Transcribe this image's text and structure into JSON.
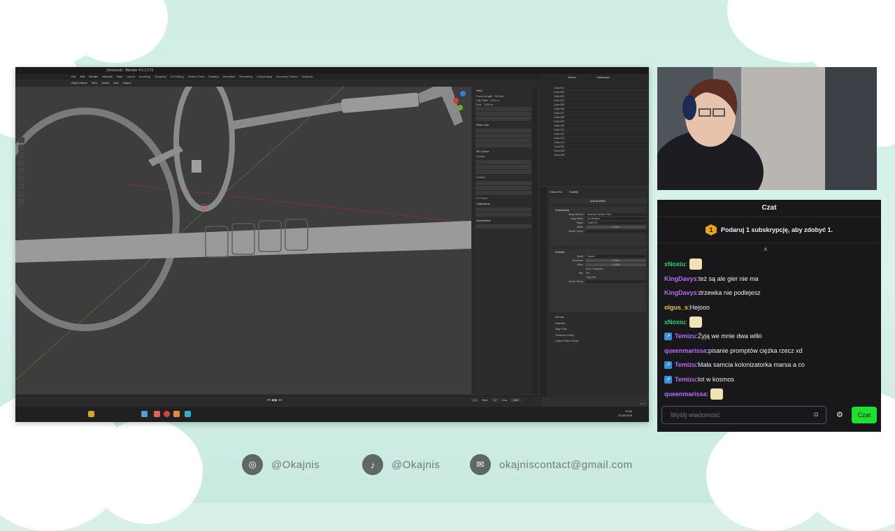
{
  "blender": {
    "title": "(Unsaved) - Blender 4.5.2 LTS",
    "menu": [
      "File",
      "Edit",
      "Render",
      "Window",
      "Help"
    ],
    "workspaces": [
      "Layout",
      "Modeling",
      "Sculpting",
      "UV Editing",
      "Texture Paint",
      "Shading",
      "Animation",
      "Rendering",
      "Compositing",
      "Geometry Nodes",
      "Scripting"
    ],
    "view_header": [
      "Object Mode",
      "View",
      "Select",
      "Add",
      "Object"
    ],
    "n_panel": {
      "view_title": "View",
      "focal_length_label": "Focal Length",
      "focal_length_value": "50 mm",
      "clip_start_label": "Clip Start",
      "clip_start_value": "0.01 m",
      "clip_end_label": "End",
      "clip_end_value": "1000 m",
      "view_lock_title": "View Lock",
      "cursor_title": "3D Cursor",
      "location_label": "Location",
      "rotation_label": "Rotation",
      "rotation_mode": "XYZ Euler",
      "collections_title": "Collections",
      "annotations_title": "Annotations"
    },
    "outliner": {
      "scene": "Scene",
      "view_layer": "ViewLayer",
      "items": [
        "Cube.001",
        "Cube.002",
        "Cube.003",
        "Cube.004",
        "Cube.005",
        "Cube.006",
        "Cube.007",
        "Cube.008",
        "Cube.009",
        "Cube.010",
        "Cube.011",
        "Cube.012",
        "Cube.013",
        "Cube.014",
        "Torus.001",
        "Torus.002",
        "Torus.003"
      ]
    },
    "properties": {
      "object_name": "Circle.001",
      "modifier_tab": "Solidify",
      "add_modifier": "Add Modifier",
      "shrinkwrap_name": "Shrinkwrap",
      "wrap_method_label": "Wrap Method",
      "wrap_method_value": "Nearest Surface Point",
      "snap_mode_label": "Snap Mode",
      "snap_mode_value": "On Surface",
      "target_label": "Target",
      "target_value": "Cube.011",
      "offset_label": "Offset",
      "offset_value": "0.15 m",
      "solidify_name": "Solidify",
      "mode_label": "Mode",
      "mode_value": "Simple",
      "thickness_label": "Thickness",
      "thickness_value": "0.15 m",
      "solidify_offset_value": "-1.0000",
      "even_thickness": "Even Thickness",
      "rim_label": "Rim",
      "fill_label": "Fill",
      "only_rim": "Only Rim",
      "vertex_group_label": "Vertex Group",
      "normals": "Normals",
      "materials": "Materials",
      "edge_data": "Edge Data",
      "thickness_clamp": "Thickness Clamp",
      "output_vertex_groups": "Output Vertex Groups"
    },
    "timeline": {
      "current_frame": "1",
      "start_label": "Start",
      "start_value": "1",
      "end_label": "End",
      "end_value": "250"
    },
    "version": "4.5.2",
    "taskbar_time": "19:52",
    "taskbar_date": "23.09.2025"
  },
  "chat": {
    "header": "Czat",
    "sub_count": "1",
    "sub_text": "Podaruj 1 subskrypcję, aby zdobyć 1.",
    "messages": [
      {
        "user": "xNoxiu",
        "text": "",
        "color": "#2ecc71",
        "emote": true,
        "badge": false
      },
      {
        "user": "KingDavys",
        "text": "też są ale gier nie ma",
        "color": "#b86bff",
        "emote": false,
        "badge": false
      },
      {
        "user": "KingDavys",
        "text": "drzewka nie podlejesz",
        "color": "#b86bff",
        "emote": false,
        "badge": false
      },
      {
        "user": "olgus_s",
        "text": "Hejooo",
        "color": "#f2c14e",
        "emote": false,
        "badge": false
      },
      {
        "user": "xNoxiu",
        "text": "",
        "color": "#2ecc71",
        "emote": true,
        "badge": false
      },
      {
        "user": "Temizu",
        "text": "Żyją we mnie dwa wilki",
        "color": "#b86bff",
        "emote": false,
        "badge": true
      },
      {
        "user": "queenmarissa",
        "text": "pisanie promptów ciężka rzecz xd",
        "color": "#b86bff",
        "emote": false,
        "badge": false
      },
      {
        "user": "Temizu",
        "text": "Mała samcia kolonizatorka marsa a co",
        "color": "#b86bff",
        "emote": false,
        "badge": true
      },
      {
        "user": "Temizu",
        "text": "lot w kosmos",
        "color": "#b86bff",
        "emote": false,
        "badge": true
      },
      {
        "user": "queenmarissa",
        "text": "",
        "color": "#b86bff",
        "emote": true,
        "badge": false
      }
    ],
    "input_placeholder": "Wyślij wiadomość",
    "send_label": "Czat"
  },
  "socials": {
    "instagram": "@Okajnis",
    "tiktok": "@Okajnis",
    "email": "okajniscontact@gmail.com"
  },
  "icons": {
    "emoji": "☺",
    "gear": "⚙",
    "scroll_down": "⩡",
    "instagram": "◎",
    "tiktok": "♪",
    "email": "✉"
  },
  "colors": {
    "background": "#d9f0e8",
    "chat_bg": "#18181b",
    "send_button": "#1fde2f",
    "sub_badge": "#e7a31b"
  }
}
